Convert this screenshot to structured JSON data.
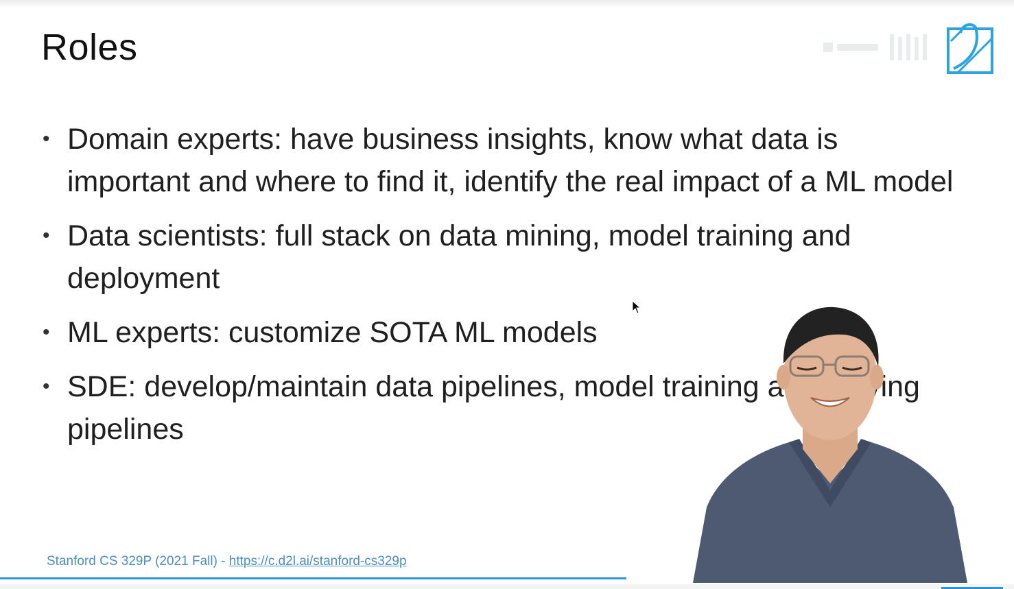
{
  "slide": {
    "title": "Roles",
    "bullets": [
      {
        "text": "Domain experts: have business insights, know what data is important and where to find it, identify the real impact of a ML model"
      },
      {
        "text": "Data scientists: full stack on data mining, model training and deployment"
      },
      {
        "text": "ML experts: customize SOTA ML models"
      },
      {
        "text": "SDE: develop/maintain data pipelines, model training and serving pipelines"
      }
    ],
    "bullet_symbol": "•"
  },
  "footer": {
    "course": "Stanford CS 329P (2021 Fall) - ",
    "link": "https://c.d2l.ai/stanford-cs329p"
  },
  "colors": {
    "accent": "#2b93d6",
    "footer_text": "#4a8fc0",
    "title_text": "#111111",
    "body_text": "#1f1f1f"
  },
  "icons": {
    "logo": "d2l-logo-icon",
    "cursor": "mouse-pointer-icon",
    "presenter": "presenter-video-overlay"
  }
}
